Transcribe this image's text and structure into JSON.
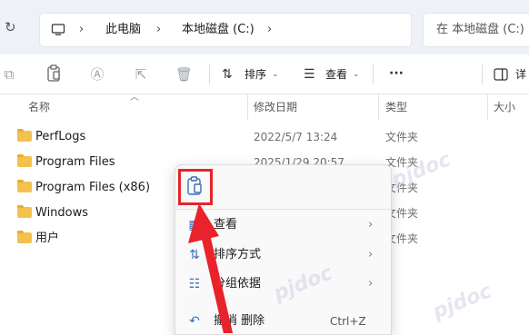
{
  "address_bar": {
    "breadcrumbs": [
      "此电脑",
      "本地磁盘 (C:)"
    ],
    "search_placeholder": "在 本地磁盘 (C:)"
  },
  "toolbar": {
    "sort_label": "排序",
    "view_label": "查看",
    "more_label": "···",
    "details_label": "详"
  },
  "columns": {
    "name": "名称",
    "date": "修改日期",
    "type": "类型",
    "size": "大小"
  },
  "files": [
    {
      "name": "PerfLogs",
      "date": "2022/5/7 13:24",
      "type": "文件夹"
    },
    {
      "name": "Program Files",
      "date": "2025/1/29 20:57",
      "type": "文件夹"
    },
    {
      "name": "Program Files (x86)",
      "date": "",
      "type": "文件夹"
    },
    {
      "name": "Windows",
      "date": "",
      "type": "文件夹"
    },
    {
      "name": "用户",
      "date": "",
      "type": "文件夹"
    }
  ],
  "context_menu": {
    "items": [
      {
        "label": "查看",
        "submenu": true
      },
      {
        "label": "排序方式",
        "submenu": true
      },
      {
        "label": "分组依据",
        "submenu": true
      },
      {
        "label": "撤消 删除",
        "shortcut": "Ctrl+Z"
      }
    ]
  },
  "colors": {
    "annotation_red": "#e8232b",
    "folder_yellow": "#f2c14e"
  },
  "icons": [
    "refresh-icon",
    "computer-icon",
    "paste-icon",
    "sort-icon",
    "view-icon",
    "details-pane-icon",
    "folder-icon",
    "arrow-annotation"
  ]
}
